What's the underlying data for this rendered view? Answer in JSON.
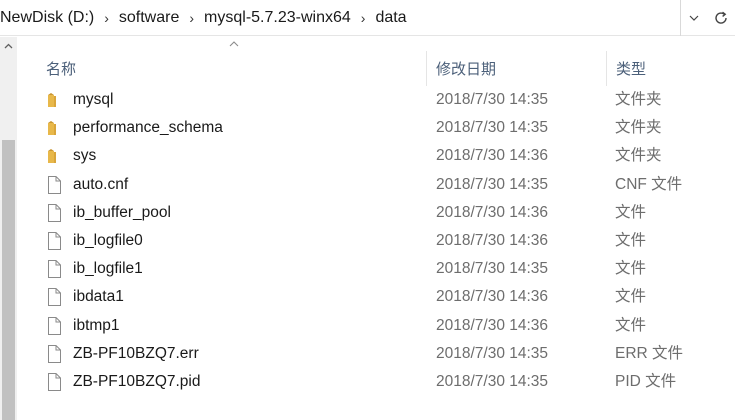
{
  "address_bar": {
    "crumbs": [
      "NewDisk (D:)",
      "software",
      "mysql-5.7.23-winx64",
      "data"
    ]
  },
  "columns": {
    "name": "名称",
    "date": "修改日期",
    "type": "类型"
  },
  "files": [
    {
      "name": "mysql",
      "date": "2018/7/30 14:35",
      "type": "文件夹",
      "icon": "folder-icon"
    },
    {
      "name": "performance_schema",
      "date": "2018/7/30 14:35",
      "type": "文件夹",
      "icon": "folder-icon"
    },
    {
      "name": "sys",
      "date": "2018/7/30 14:36",
      "type": "文件夹",
      "icon": "folder-icon"
    },
    {
      "name": "auto.cnf",
      "date": "2018/7/30 14:35",
      "type": "CNF 文件",
      "icon": "file-icon"
    },
    {
      "name": "ib_buffer_pool",
      "date": "2018/7/30 14:36",
      "type": "文件",
      "icon": "file-icon"
    },
    {
      "name": "ib_logfile0",
      "date": "2018/7/30 14:36",
      "type": "文件",
      "icon": "file-icon"
    },
    {
      "name": "ib_logfile1",
      "date": "2018/7/30 14:35",
      "type": "文件",
      "icon": "file-icon"
    },
    {
      "name": "ibdata1",
      "date": "2018/7/30 14:36",
      "type": "文件",
      "icon": "file-icon"
    },
    {
      "name": "ibtmp1",
      "date": "2018/7/30 14:36",
      "type": "文件",
      "icon": "file-icon"
    },
    {
      "name": "ZB-PF10BZQ7.err",
      "date": "2018/7/30 14:35",
      "type": "ERR 文件",
      "icon": "file-icon"
    },
    {
      "name": "ZB-PF10BZQ7.pid",
      "date": "2018/7/30 14:35",
      "type": "PID 文件",
      "icon": "file-icon"
    }
  ],
  "colors": {
    "folder": "#e8b84a",
    "header_text": "#4c607a",
    "secondary_text": "#6d6d6d"
  }
}
